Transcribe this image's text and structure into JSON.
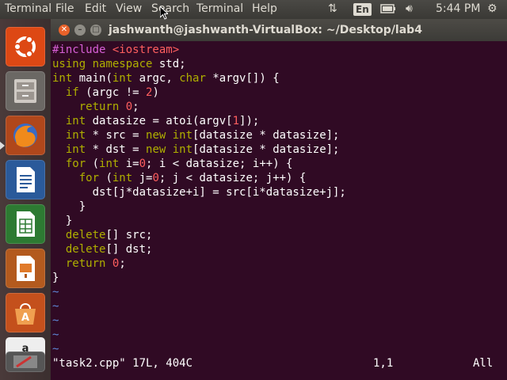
{
  "panel": {
    "app_name": "Terminal",
    "menus": [
      "File",
      "Edit",
      "View",
      "Search",
      "Terminal",
      "Help"
    ],
    "keyboard_layout": "En",
    "clock": "5:44 PM"
  },
  "window": {
    "title": "jashwanth@jashwanth-VirtualBox: ~/Desktop/lab4"
  },
  "editor": {
    "lines": [
      [
        {
          "t": "#include ",
          "c": "pp"
        },
        {
          "t": "<iostream>",
          "c": "str"
        }
      ],
      [
        {
          "t": "using",
          "c": "k"
        },
        {
          "t": " "
        },
        {
          "t": "namespace",
          "c": "k"
        },
        {
          "t": " std;"
        }
      ],
      [
        {
          "t": "int",
          "c": "k"
        },
        {
          "t": " main("
        },
        {
          "t": "int",
          "c": "k"
        },
        {
          "t": " argc, "
        },
        {
          "t": "char",
          "c": "k"
        },
        {
          "t": " *argv[]) {"
        }
      ],
      [
        {
          "t": "  "
        },
        {
          "t": "if",
          "c": "k"
        },
        {
          "t": " (argc != "
        },
        {
          "t": "2",
          "c": "num"
        },
        {
          "t": ")"
        }
      ],
      [
        {
          "t": "    "
        },
        {
          "t": "return",
          "c": "k"
        },
        {
          "t": " "
        },
        {
          "t": "0",
          "c": "num"
        },
        {
          "t": ";"
        }
      ],
      [
        {
          "t": "  "
        },
        {
          "t": "int",
          "c": "k"
        },
        {
          "t": " datasize = atoi(argv["
        },
        {
          "t": "1",
          "c": "num"
        },
        {
          "t": "]);"
        }
      ],
      [
        {
          "t": "  "
        },
        {
          "t": "int",
          "c": "k"
        },
        {
          "t": " * src = "
        },
        {
          "t": "new",
          "c": "k"
        },
        {
          "t": " "
        },
        {
          "t": "int",
          "c": "k"
        },
        {
          "t": "[datasize * datasize];"
        }
      ],
      [
        {
          "t": "  "
        },
        {
          "t": "int",
          "c": "k"
        },
        {
          "t": " * dst = "
        },
        {
          "t": "new",
          "c": "k"
        },
        {
          "t": " "
        },
        {
          "t": "int",
          "c": "k"
        },
        {
          "t": "[datasize * datasize];"
        }
      ],
      [
        {
          "t": "  "
        },
        {
          "t": "for",
          "c": "k"
        },
        {
          "t": " ("
        },
        {
          "t": "int",
          "c": "k"
        },
        {
          "t": " i="
        },
        {
          "t": "0",
          "c": "num"
        },
        {
          "t": "; i < datasize; i++) {"
        }
      ],
      [
        {
          "t": "    "
        },
        {
          "t": "for",
          "c": "k"
        },
        {
          "t": " ("
        },
        {
          "t": "int",
          "c": "k"
        },
        {
          "t": " j="
        },
        {
          "t": "0",
          "c": "num"
        },
        {
          "t": "; j < datasize; j++) {"
        }
      ],
      [
        {
          "t": "      dst[j*datasize+i] = src[i*datasize+j];"
        }
      ],
      [
        {
          "t": "    }"
        }
      ],
      [
        {
          "t": "  }"
        }
      ],
      [
        {
          "t": "  "
        },
        {
          "t": "delete",
          "c": "k"
        },
        {
          "t": "[] src;"
        }
      ],
      [
        {
          "t": "  "
        },
        {
          "t": "delete",
          "c": "k"
        },
        {
          "t": "[] dst;"
        }
      ],
      [
        {
          "t": "  "
        },
        {
          "t": "return",
          "c": "k"
        },
        {
          "t": " "
        },
        {
          "t": "0",
          "c": "num"
        },
        {
          "t": ";"
        }
      ],
      [
        {
          "t": "}"
        }
      ]
    ],
    "tilde": "~",
    "tilde_count": 5,
    "status_file": "\"task2.cpp\" 17L, 404C",
    "status_position": "1,1",
    "status_scroll": "All"
  },
  "colors": {
    "terminal_bg": "#300a24",
    "keyword": "#afaf00",
    "preprocessor": "#d75fd7",
    "literal": "#ff5f5f",
    "tilde": "#5f87d7"
  },
  "launcher": {
    "icons": [
      "ubuntu-dash-icon",
      "files-icon",
      "firefox-icon",
      "writer-icon",
      "calc-icon",
      "impress-icon",
      "software-center-icon",
      "amazon-icon",
      "system-settings-icon"
    ]
  }
}
